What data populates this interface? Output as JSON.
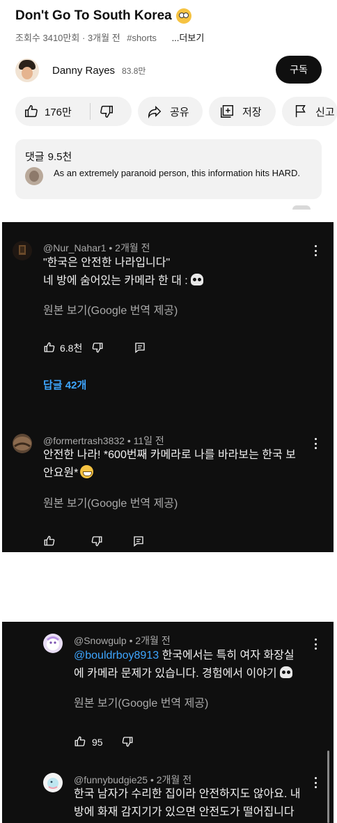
{
  "video": {
    "title": "Don't Go To South Korea",
    "title_emoji": "flushed-face-icon",
    "views": "조회수 3410만회",
    "separator": "·",
    "age": "3개월 전",
    "hashtag": "#shorts",
    "more": "...더보기"
  },
  "channel": {
    "name": "Danny Rayes",
    "subscribers": "83.8만",
    "subscribe_label": "구독"
  },
  "actions": {
    "like_count": "176만",
    "share_label": "공유",
    "save_label": "저장",
    "report_label": "신고"
  },
  "comments_preview": {
    "label": "댓글",
    "count": "9.5천",
    "teaser_text": "As an extremely paranoid person, this information hits HARD."
  },
  "comments": [
    {
      "author": "@Nur_Nahar1",
      "age": "2개월 전",
      "line1": "\"한국은 안전한 나라입니다\"",
      "line2": "네 방에 숨어있는 카메라 한 대 :",
      "translate": "원본 보기(Google 번역 제공)",
      "likes": "6.8천",
      "replies": "답글 42개"
    },
    {
      "author": "@formertrash3832",
      "age": "11일 전",
      "line1": "안전한 나라! *600번째 카메라로 나를 바라보는 한국 보",
      "line2": "안요원*",
      "translate": "원본 보기(Google 번역 제공)",
      "likes": ""
    },
    {
      "author": "@Snowgulp",
      "age": "2개월 전",
      "mention": "@bouldrboy8913",
      "line1": "한국에서는 특히 여자 화장실",
      "line2": "에 카메라 문제가 있습니다. 경험에서 이야기",
      "translate": "원본 보기(Google 번역 제공)",
      "likes": "95"
    },
    {
      "author": "@funnybudgie25",
      "age": "2개월 전",
      "line1": "한국 남자가 수리한 집이라 안전하지도 않아요. 내",
      "line2": "방에 화재 감지기가 있으면 안전도가 떨어집니다"
    }
  ],
  "colors": {
    "dark_bg": "#0f0f0f",
    "link_blue": "#3ea6ff",
    "pill_bg": "#f2f2f2"
  }
}
